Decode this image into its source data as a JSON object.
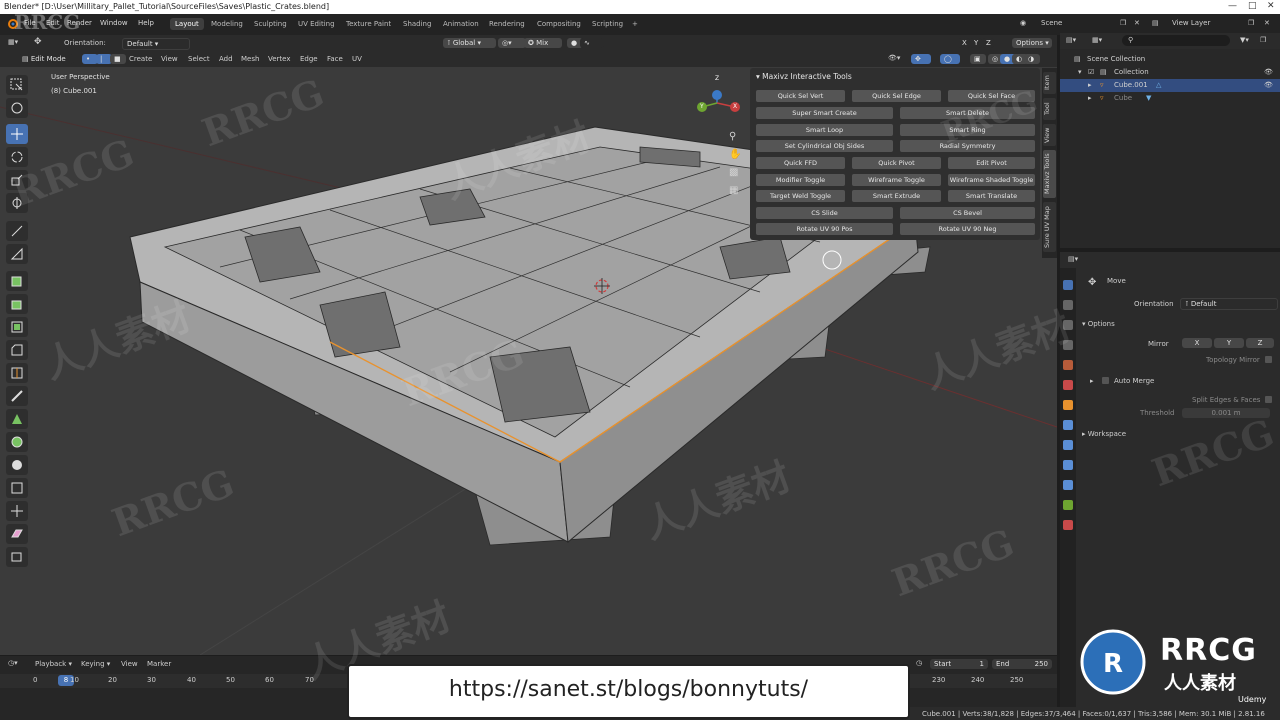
{
  "window": {
    "title": "Blender* [D:\\User\\Millitary_Pallet_Tutorial\\SourceFiles\\Saves\\Plastic_Crates.blend]"
  },
  "menu": [
    "File",
    "Edit",
    "Render",
    "Window",
    "Help"
  ],
  "workspaces": {
    "tabs": [
      "Layout",
      "Modeling",
      "Sculpting",
      "UV Editing",
      "Texture Paint",
      "Shading",
      "Animation",
      "Rendering",
      "Compositing",
      "Scripting"
    ],
    "active": "Layout",
    "add_label": "+"
  },
  "scene_selector": {
    "scene": "Scene",
    "view_layer": "View Layer"
  },
  "tool_header": {
    "orientation_label": "Orientation:",
    "orientation_value": "Default",
    "transform_orientation": "Global",
    "snap_mode": "Mix",
    "axes": [
      "X",
      "Y",
      "Z"
    ],
    "options_label": "Options"
  },
  "editor_header": {
    "mode": "Edit Mode",
    "menus": [
      "Create",
      "View",
      "Select",
      "Add",
      "Mesh",
      "Vertex",
      "Edge",
      "Face",
      "UV"
    ]
  },
  "viewport": {
    "perspective": "User Perspective",
    "object": "(8) Cube.001",
    "gizmo": {
      "x": "X",
      "y": "Y",
      "z": "Z"
    }
  },
  "addon_panel": {
    "title": "Maxivz Interactive Tools",
    "row1": [
      "Quick Sel Vert",
      "Quick Sel Edge",
      "Quick Sel Face"
    ],
    "row2": [
      "Super Smart Create",
      "Smart Delete"
    ],
    "row3": [
      "Smart Loop",
      "Smart Ring"
    ],
    "row4": [
      "Set Cylindrical Obj Sides",
      "Radial Symmetry"
    ],
    "row5": [
      "Quick FFD",
      "Quick Pivot",
      "Edit Pivot"
    ],
    "row6": [
      "Modifier Toggle",
      "Wireframe Toggle",
      "Wireframe Shaded Toggle"
    ],
    "row7": [
      "Target Weld Toggle",
      "Smart Extrude",
      "Smart Translate"
    ],
    "row8": [
      "CS Slide",
      "CS Bevel"
    ],
    "row9": [
      "Rotate UV 90 Pos",
      "Rotate UV 90 Neg"
    ]
  },
  "side_tabs": [
    "Item",
    "Tool",
    "View",
    "Maxivz Tools",
    "Sure UV Map"
  ],
  "outliner": {
    "search_placeholder": "",
    "items": [
      "Scene Collection",
      "Collection",
      "Cube.001",
      "Cube"
    ]
  },
  "properties": {
    "tool_name": "Move",
    "orientation_label": "Orientation",
    "orientation_value": "Default",
    "options_label": "Options",
    "mirror_label": "Mirror",
    "mirror_axes": [
      "X",
      "Y",
      "Z"
    ],
    "topology_mirror": "Topology Mirror",
    "auto_merge": "Auto Merge",
    "split_edges": "Split Edges & Faces",
    "threshold_label": "Threshold",
    "threshold_value": "0.001 m",
    "workspace_label": "Workspace"
  },
  "timeline": {
    "menus": [
      "Playback",
      "Keying",
      "View",
      "Marker"
    ],
    "current_frame": "8",
    "start_label": "Start",
    "start_value": "1",
    "end_label": "End",
    "end_value": "250",
    "ruler": [
      "0",
      "10",
      "20",
      "30",
      "40",
      "50",
      "60",
      "70",
      "230",
      "240",
      "250"
    ]
  },
  "status_bar": "Cube.001 | Verts:38/1,828 | Edges:37/3,464 | Faces:0/1,637 | Tris:3,586 | Mem: 30.1 MiB | 2.81.16",
  "overlay": {
    "url": "https://sanet.st/blogs/bonnytuts/",
    "watermark": "RRCG",
    "watermark_cn": "人人素材",
    "logo_text": "RRCG",
    "logo_sub": "人人素材",
    "udemy": "Udemy"
  },
  "colors": {
    "accent": "#4772b3",
    "mesh": "#a9a9a9",
    "viewport_bg": "#3b3b3b",
    "selection": "#e8922e"
  }
}
